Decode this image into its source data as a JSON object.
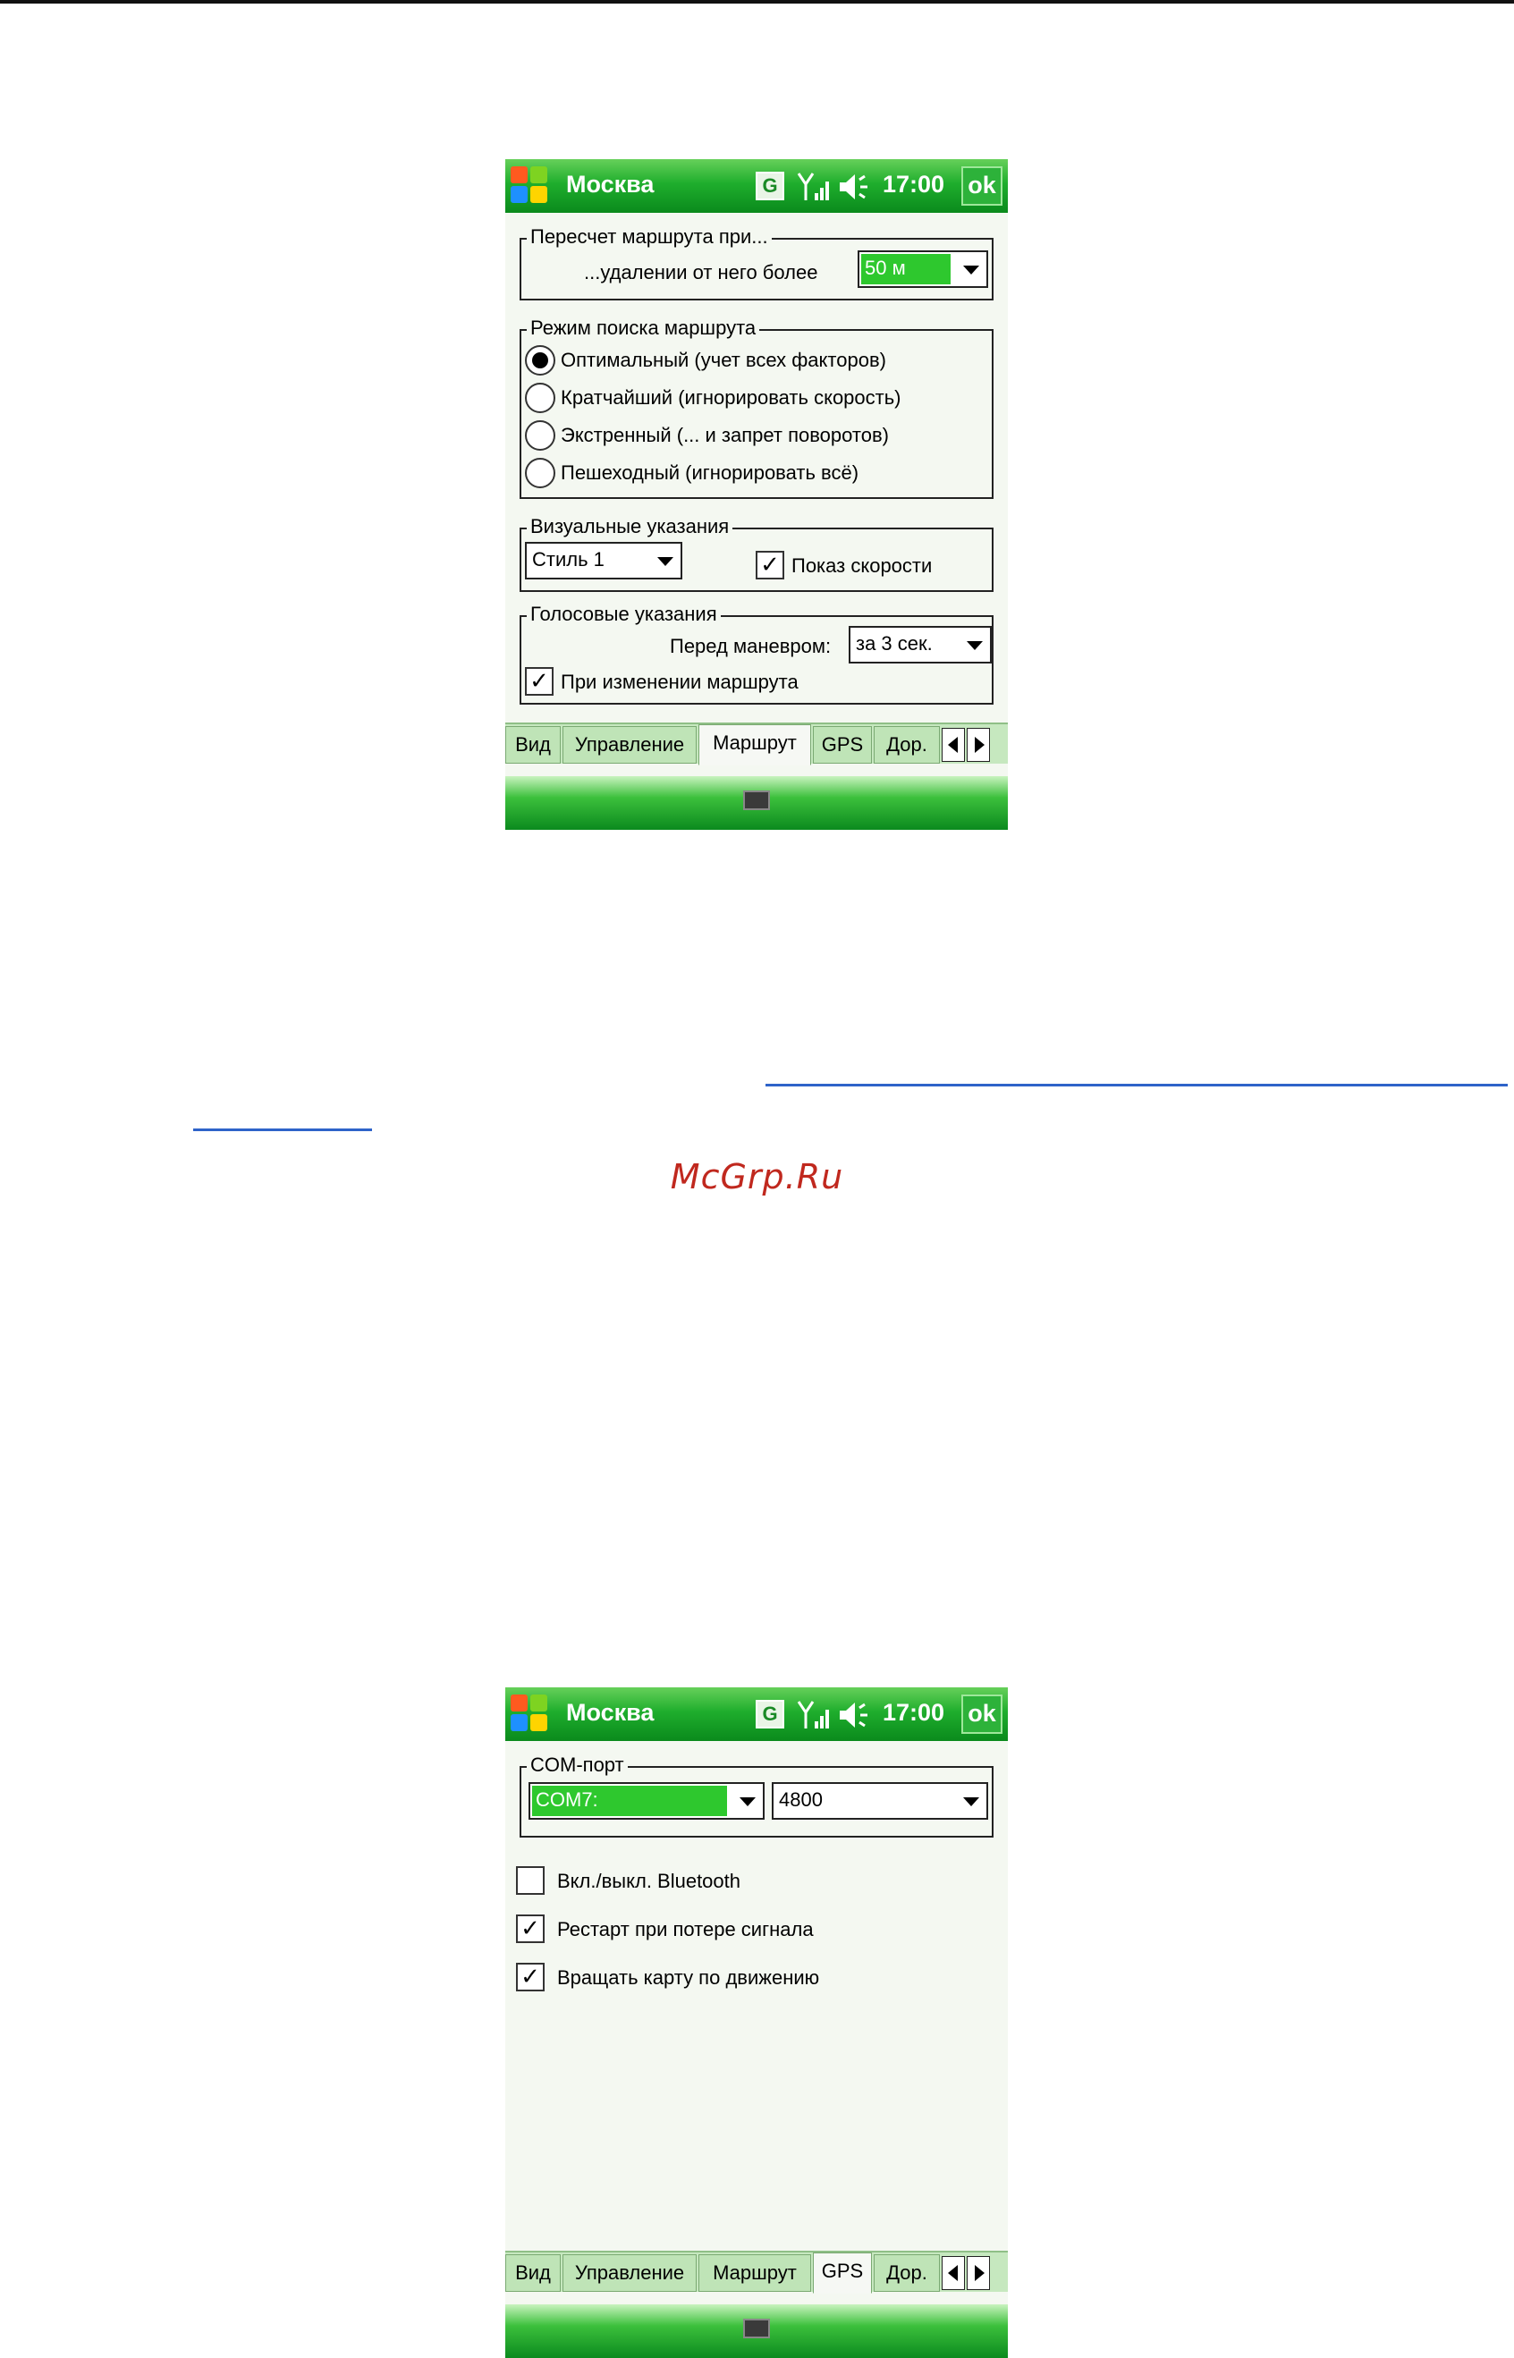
{
  "watermark": "McGrp.Ru",
  "statusbar": {
    "title": "Москва",
    "g_badge": "G",
    "time": "17:00",
    "ok_label": "ok"
  },
  "screen1": {
    "reroute": {
      "legend": "Пересчет маршрута при...",
      "distance_label": "...удалении от него более",
      "distance_value": "50 м"
    },
    "search_mode": {
      "legend": "Режим поиска маршрута",
      "options": [
        {
          "label": "Оптимальный  (учет всех факторов)",
          "selected": true
        },
        {
          "label": "Кратчайший  (игнорировать скорость)",
          "selected": false
        },
        {
          "label": "Экстренный  (... и запрет поворотов)",
          "selected": false
        },
        {
          "label": "Пешеходный  (игнорировать всё)",
          "selected": false
        }
      ]
    },
    "visual": {
      "legend": "Визуальные указания",
      "style_value": "Стиль 1",
      "speed_label": "Показ скорости",
      "speed_checked": true
    },
    "voice": {
      "legend": "Голосовые указания",
      "before_label": "Перед маневром:",
      "before_value": "за 3 сек.",
      "on_change_label": "При изменении маршрута",
      "on_change_checked": true
    },
    "tabs": [
      "Вид",
      "Управление",
      "Маршрут",
      "GPS",
      "Дор."
    ],
    "active_tab": "Маршрут"
  },
  "screen2": {
    "com": {
      "legend": "COM-порт",
      "port_value": "COM7:",
      "baud_value": "4800"
    },
    "checkboxes": [
      {
        "label": "Вкл./выкл. Bluetooth",
        "checked": false
      },
      {
        "label": "Рестарт при потере сигнала",
        "checked": true
      },
      {
        "label": "Вращать карту по движению",
        "checked": true
      }
    ],
    "tabs": [
      "Вид",
      "Управление",
      "Маршрут",
      "GPS",
      "Дор."
    ],
    "active_tab": "GPS"
  }
}
